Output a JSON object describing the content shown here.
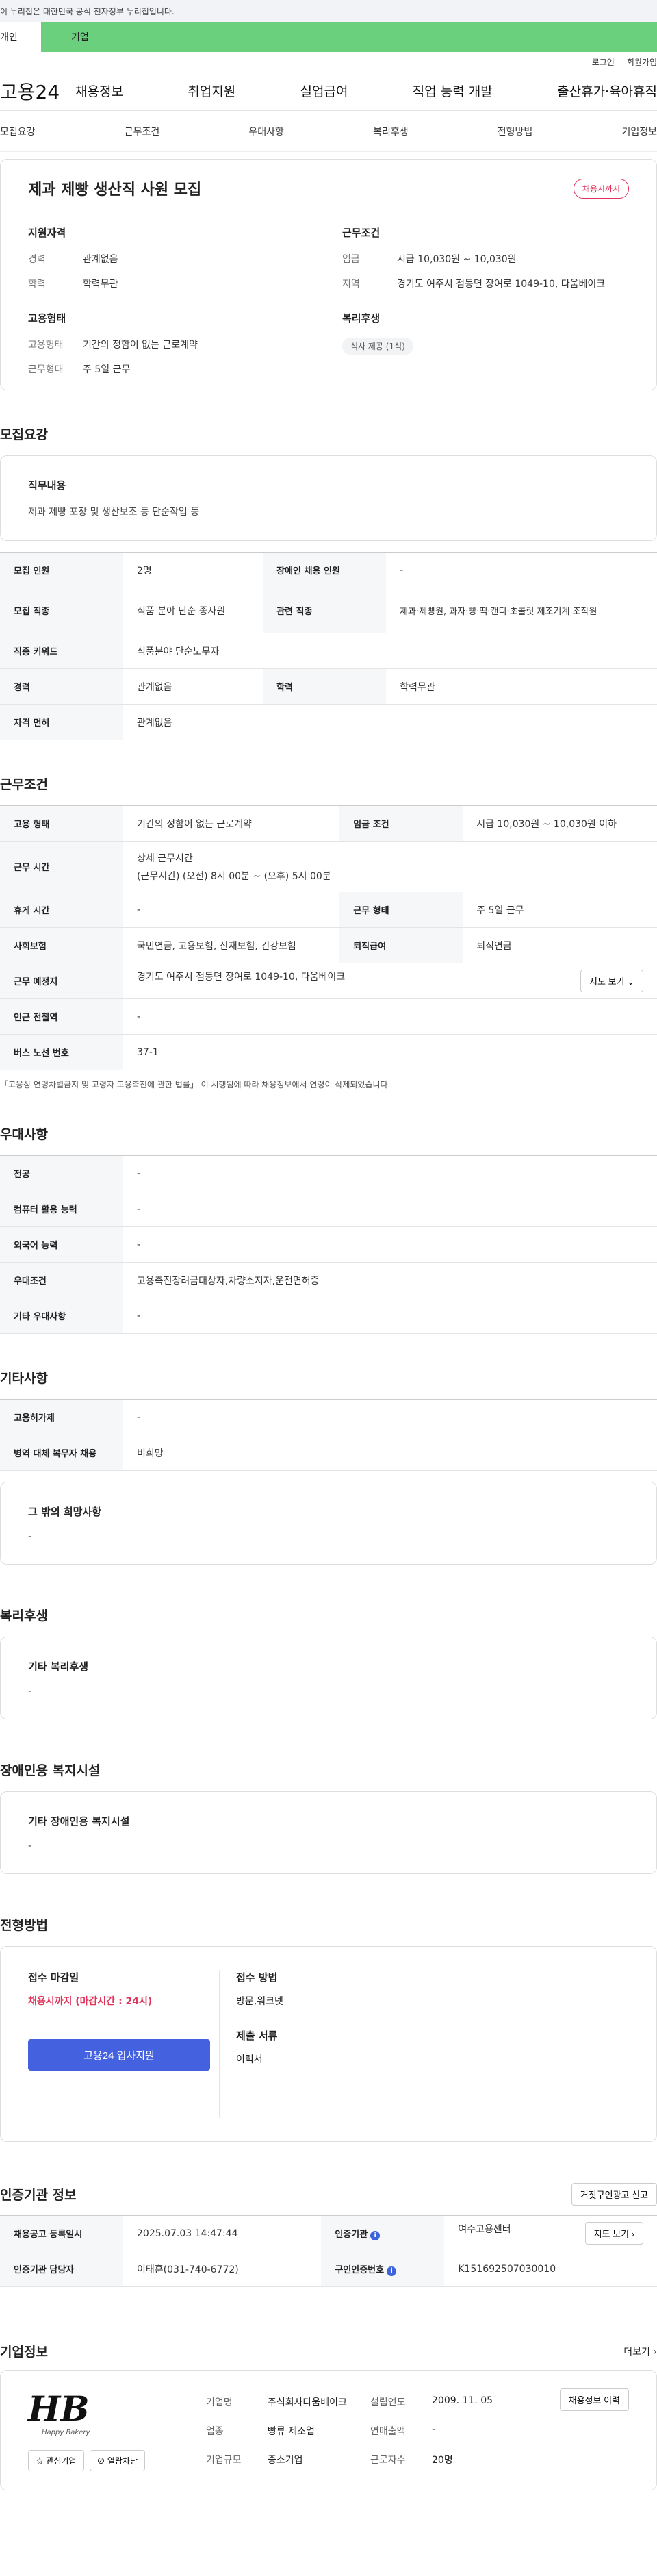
{
  "gov_banner": "이 누리집은 대한민국 공식 전자정부 누리집입니다.",
  "user_tabs": {
    "person": "개인",
    "corp": "기업"
  },
  "util": {
    "login": "로그인",
    "join": "회원가입"
  },
  "logo": "고용24",
  "gnb": [
    "채용정보",
    "취업지원",
    "실업급여",
    "직업 능력 개발",
    "출산휴가·육아휴직"
  ],
  "snb": [
    "모집요강",
    "근무조건",
    "우대사항",
    "복리후생",
    "전형방법",
    "기업정보"
  ],
  "summary": {
    "title": "제과 제빵 생산직 사원 모집",
    "badge": "채용시까지",
    "qual_title": "지원자격",
    "career_k": "경력",
    "career_v": "관계없음",
    "edu_k": "학력",
    "edu_v": "학력무관",
    "emp_title": "고용형태",
    "emptype_k": "고용형태",
    "emptype_v": "기간의 정함이 없는 근로계약",
    "worktype_k": "근무형태",
    "worktype_v": "주 5일 근무",
    "cond_title": "근무조건",
    "wage_k": "임금",
    "wage_v": "시급 10,030원 ~ 10,030원",
    "region_k": "지역",
    "region_v": "경기도 여주시 점동면 장여로 1049-10, 다움베이크",
    "welfare_title": "복리후생",
    "welfare_chip": "식사 제공 (1식)"
  },
  "recruit": {
    "section": "모집요강",
    "duty_title": "직무내용",
    "duty_value": "제과 제빵 포장 및 생산보조 등 단순작업 등",
    "r1": {
      "k1": "모집 인원",
      "v1": "2명",
      "k2": "장애인 채용 인원",
      "v2": "-"
    },
    "r2": {
      "k1": "모집 직종",
      "v1": "식품 분야 단순 종사원",
      "k2": "관련 직종",
      "v2": "제과·제빵원, 과자·빵·떡·캔디·초콜릿 제조기계 조작원"
    },
    "r3": {
      "k1": "직종 키워드",
      "v1": "식품분야 단순노무자"
    },
    "r4": {
      "k1": "경력",
      "v1": "관계없음",
      "k2": "학력",
      "v2": "학력무관"
    },
    "r5": {
      "k1": "자격 면허",
      "v1": "관계없음"
    }
  },
  "work": {
    "section": "근무조건",
    "r1": {
      "k1": "고용 형태",
      "v1": "기간의 정함이 없는 근로계약",
      "k2": "임금 조건",
      "v2": "시급 10,030원 ~ 10,030원 이하"
    },
    "r2": {
      "k1": "근무 시간",
      "v1a": "상세 근무시간",
      "v1b": "(근무시간) (오전) 8시 00분 ~ (오후) 5시 00분"
    },
    "r3": {
      "k1": "휴게 시간",
      "v1": "-",
      "k2": "근무 형태",
      "v2": "주 5일 근무"
    },
    "r4": {
      "k1": "사회보험",
      "v1": "국민연금, 고용보험, 산재보험, 건강보험",
      "k2": "퇴직급여",
      "v2": "퇴직연금"
    },
    "r5": {
      "k1": "근무 예정지",
      "v1": "경기도 여주시 점동면 장여로 1049-10, 다움베이크",
      "btn": "지도 보기 ⌄"
    },
    "r6": {
      "k1": "인근 전철역",
      "v1": "-"
    },
    "r7": {
      "k1": "버스 노선 번호",
      "v1": "37-1"
    },
    "note": "「고용상 연령차별금지 및 고령자 고용촉진에 관한 법률」 이 시행됨에 따라 채용정보에서 연령이 삭제되었습니다."
  },
  "pref": {
    "section": "우대사항",
    "rows": [
      {
        "k": "전공",
        "v": "-"
      },
      {
        "k": "컴퓨터 활용 능력",
        "v": "-"
      },
      {
        "k": "외국어 능력",
        "v": "-"
      },
      {
        "k": "우대조건",
        "v": "고용촉진장려금대상자,차량소지자,운전면허증"
      },
      {
        "k": "기타 우대사항",
        "v": "-"
      }
    ]
  },
  "etc": {
    "section": "기타사항",
    "rows": [
      {
        "k": "고용허가제",
        "v": "-"
      },
      {
        "k": "병역 대체 복무자 채용",
        "v": "비희망"
      }
    ],
    "box_title": "그 밖의 희망사항",
    "box_value": "-"
  },
  "welfare": {
    "section": "복리후생",
    "box_title": "기타 복리후생",
    "box_value": "-"
  },
  "disabled": {
    "section": "장애인용 복지시설",
    "box_title": "기타 장애인용 복지시설",
    "box_value": "-"
  },
  "selection": {
    "section": "전형방법",
    "deadline_label": "접수 마감일",
    "deadline_value": "채용시까지 (마감시간 : 24시)",
    "apply_btn": "고용24 입사지원",
    "method_label": "접수 방법",
    "method_value": "방문,워크넷",
    "docs_label": "제출 서류",
    "docs_value": "이력서"
  },
  "inst": {
    "section": "인증기관 정보",
    "report_btn": "거짓구인광고 신고",
    "r1": {
      "k1": "채용공고 등록일시",
      "v1": "2025.07.03 14:47:44",
      "k2": "인증기관",
      "v2": "여주고용센터",
      "btn": "지도 보기 ›"
    },
    "r2": {
      "k1": "인증기관 담당자",
      "v1": "이태훈(031-740-6772)",
      "k2": "구인인증번호",
      "v2": "K151692507030010"
    },
    "info_icon": "i"
  },
  "company": {
    "section": "기업정보",
    "more": "더보기 ›",
    "logo_text": "HB",
    "logo_sub": "Happy Bakery",
    "fav_btn": "☆ 관심기업",
    "block_btn": "⊘ 열람차단",
    "name_k": "기업명",
    "name_v": "주식회사다움베이크",
    "industry_k": "업종",
    "industry_v": "빵류 제조업",
    "size_k": "기업규모",
    "size_v": "중소기업",
    "founded_k": "설립연도",
    "founded_v": "2009. 11. 05",
    "sales_k": "연매출액",
    "sales_v": "-",
    "staff_k": "근로자수",
    "staff_v": "20명",
    "history_btn": "채용정보 이력"
  }
}
